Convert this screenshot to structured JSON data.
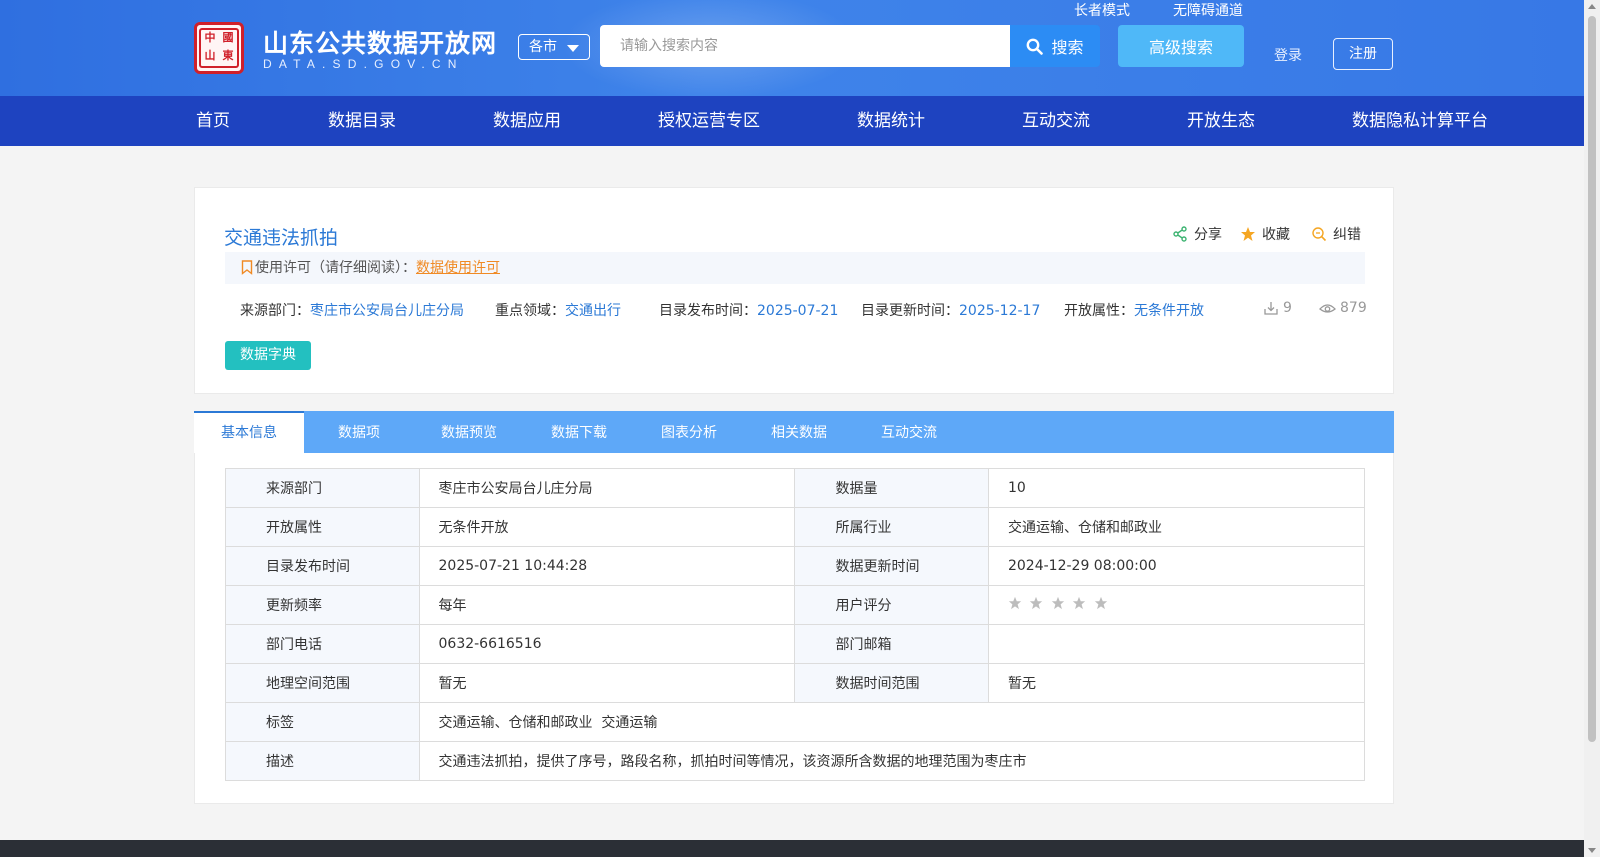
{
  "header": {
    "site_title": "山东公共数据开放网",
    "site_domain": "DATA.SD.GOV.CN",
    "seal_chars": [
      "中",
      "國",
      "山",
      "東"
    ],
    "city_select": "各市",
    "search_placeholder": "请输入搜索内容",
    "search_button": "搜索",
    "advanced_search": "高级搜索",
    "elder_mode": "长者模式",
    "accessibility": "无障碍通道",
    "login": "登录",
    "register": "注册"
  },
  "nav": [
    "首页",
    "数据目录",
    "数据应用",
    "授权运营专区",
    "数据统计",
    "互动交流",
    "开放生态",
    "数据隐私计算平台"
  ],
  "dataset": {
    "title": "交通违法抓拍",
    "share": "分享",
    "favorite": "收藏",
    "correct": "纠错",
    "license_prefix": "使用许可（请仔细阅读）：",
    "license_link": "数据使用许可",
    "source_label": "来源部门：",
    "source_value": "枣庄市公安局台儿庄分局",
    "domain_label": "重点领域：",
    "domain_value": "交通出行",
    "publish_label": "目录发布时间：",
    "publish_value": "2025-07-21",
    "update_label": "目录更新时间：",
    "update_value": "2025-12-17",
    "open_label": "开放属性：",
    "open_value": "无条件开放",
    "downloads": "9",
    "views": "879",
    "dict_button": "数据字典"
  },
  "tabs": [
    "基本信息",
    "数据项",
    "数据预览",
    "数据下载",
    "图表分析",
    "相关数据",
    "互动交流"
  ],
  "info_table": {
    "rows": [
      {
        "k1": "来源部门",
        "v1": "枣庄市公安局台儿庄分局",
        "k2": "数据量",
        "v2": "10"
      },
      {
        "k1": "开放属性",
        "v1": "无条件开放",
        "k2": "所属行业",
        "v2": "交通运输、仓储和邮政业"
      },
      {
        "k1": "目录发布时间",
        "v1": "2025-07-21 10:44:28",
        "k2": "数据更新时间",
        "v2": "2024-12-29 08:00:00"
      },
      {
        "k1": "更新频率",
        "v1": "每年",
        "k2": "用户评分",
        "v2": ""
      },
      {
        "k1": "部门电话",
        "v1": "0632-6616516",
        "k2": "部门邮箱",
        "v2": ""
      },
      {
        "k1": "地理空间范围",
        "v1": "暂无",
        "k2": "数据时间范围",
        "v2": "暂无"
      }
    ],
    "tags_label": "标签",
    "tags_value": "交通运输、仓储和邮政业  交通运输",
    "desc_label": "描述",
    "desc_value": "交通违法抓拍，提供了序号，路段名称，抓拍时间等情况，该资源所含数据的地理范围为枣庄市",
    "rating_stars": 0,
    "rating_max": 5
  },
  "colors": {
    "header_blue": "#3778e6",
    "nav_blue": "#1e43c0",
    "link_blue": "#2b79d6",
    "tab_blue": "#5ea8f8",
    "teal": "#23c0c0",
    "license_orange": "#f08a24"
  }
}
